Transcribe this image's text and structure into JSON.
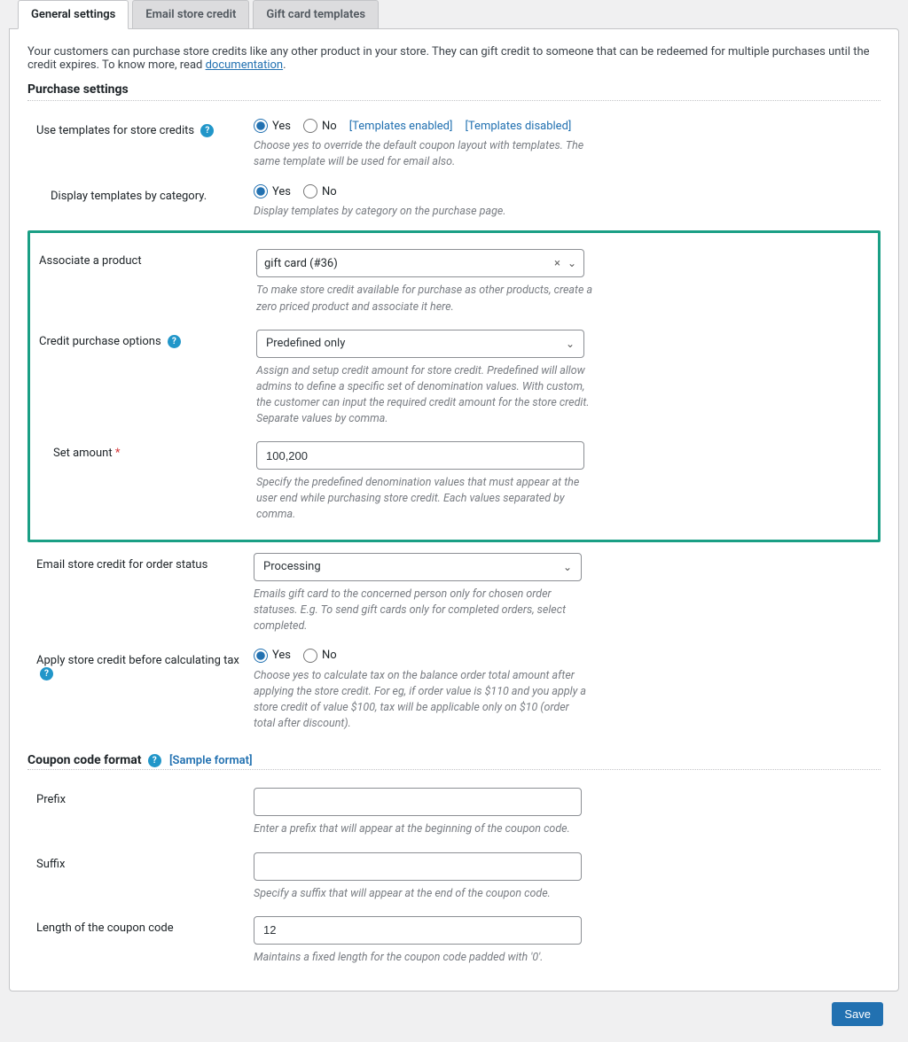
{
  "tabs": {
    "general": "General settings",
    "email": "Email store credit",
    "gift": "Gift card templates"
  },
  "intro": {
    "text1": "Your customers can purchase store credits like any other product in your store. They can gift credit to someone that can be redeemed for multiple purchases until the credit expires. To know more, read ",
    "doc_link": "documentation",
    "text2": "."
  },
  "sections": {
    "purchase_title": "Purchase settings",
    "coupon_title": "Coupon code format"
  },
  "fields": {
    "use_templates": {
      "label": "Use templates for store credits",
      "yes": "Yes",
      "no": "No",
      "enabled_link": "[Templates enabled]",
      "disabled_link": "[Templates disabled]",
      "desc": "Choose yes to override the default coupon layout with templates. The same template will be used for email also."
    },
    "display_category": {
      "label": "Display templates by category.",
      "yes": "Yes",
      "no": "No",
      "desc": "Display templates by category on the purchase page."
    },
    "associate_product": {
      "label": "Associate a product",
      "value": "gift card (#36)",
      "desc": "To make store credit available for purchase as other products, create a zero priced product and associate it here."
    },
    "credit_options": {
      "label": "Credit purchase options",
      "value": "Predefined only",
      "desc": "Assign and setup credit amount for store credit. Predefined will allow admins to define a specific set of denomination values. With custom, the customer can input the required credit amount for the store credit. Separate values by comma."
    },
    "set_amount": {
      "label": "Set amount",
      "value": "100,200",
      "desc": "Specify the predefined denomination values that must appear at the user end while purchasing store credit. Each values separated by comma."
    },
    "email_status": {
      "label": "Email store credit for order status",
      "value": "Processing",
      "desc": "Emails gift card to the concerned person only for chosen order statuses. E.g. To send gift cards only for completed orders, select completed."
    },
    "apply_tax": {
      "label": "Apply store credit before calculating tax",
      "yes": "Yes",
      "no": "No",
      "desc": "Choose yes to calculate tax on the balance order total amount after applying the store credit. For eg, if order value is $110 and you apply a store credit of value $100, tax will be applicable only on $10 (order total after discount)."
    },
    "sample_format": "[Sample format]",
    "prefix": {
      "label": "Prefix",
      "value": "",
      "desc": "Enter a prefix that will appear at the beginning of the coupon code."
    },
    "suffix": {
      "label": "Suffix",
      "value": "",
      "desc": "Specify a suffix that will appear at the end of the coupon code."
    },
    "length": {
      "label": "Length of the coupon code",
      "value": "12",
      "desc": "Maintains a fixed length for the coupon code padded with '0'."
    }
  },
  "buttons": {
    "save": "Save"
  }
}
